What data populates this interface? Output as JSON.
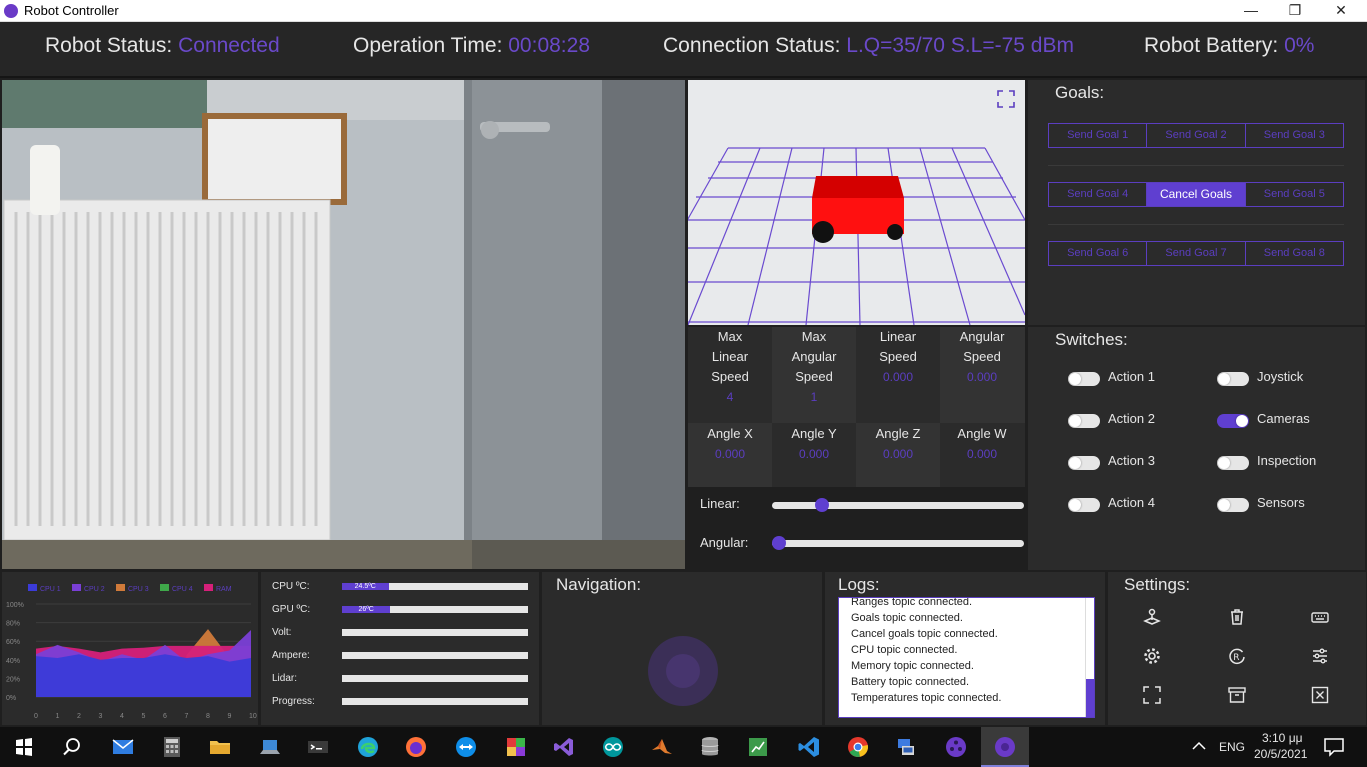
{
  "window": {
    "title": "Robot Controller",
    "minimize": "—",
    "restore": "❐",
    "close": "✕"
  },
  "status": {
    "robot_status_label": "Robot Status:",
    "robot_status_value": "Connected",
    "operation_time_label": "Operation Time:",
    "operation_time_value": "00:08:28",
    "connection_status_label": "Connection Status:",
    "connection_status_value": "L.Q=35/70 S.L=-75 dBm",
    "battery_label": "Robot Battery:",
    "battery_value": "0%"
  },
  "metrics": {
    "max_linear_label": [
      "Max",
      "Linear",
      "Speed"
    ],
    "max_linear_value": "4",
    "max_angular_label": [
      "Max",
      "Angular",
      "Speed"
    ],
    "max_angular_value": "1",
    "linear_speed_label": [
      "Linear",
      "Speed"
    ],
    "linear_speed_value": "0.000",
    "angular_speed_label": [
      "Angular",
      "Speed"
    ],
    "angular_speed_value": "0.000",
    "angle_x_label": "Angle X",
    "angle_x_value": "0.000",
    "angle_y_label": "Angle Y",
    "angle_y_value": "0.000",
    "angle_z_label": "Angle Z",
    "angle_z_value": "0.000",
    "angle_w_label": "Angle W",
    "angle_w_value": "0.000"
  },
  "sliders": {
    "linear_label": "Linear:",
    "linear_level": 0.18,
    "angular_label": "Angular:",
    "angular_level": 0.0
  },
  "goals": {
    "title": "Goals:",
    "rows": [
      [
        "Send Goal 1",
        "Send Goal 2",
        "Send Goal 3"
      ],
      [
        "Send Goal 4",
        "Cancel Goals",
        "Send Goal 5"
      ],
      [
        "Send Goal 6",
        "Send Goal 7",
        "Send Goal 8"
      ]
    ]
  },
  "switches": {
    "title": "Switches:",
    "left": [
      {
        "label": "Action 1",
        "on": false
      },
      {
        "label": "Action 2",
        "on": false
      },
      {
        "label": "Action 3",
        "on": false
      },
      {
        "label": "Action 4",
        "on": false
      }
    ],
    "right": [
      {
        "label": "Joystick",
        "on": false
      },
      {
        "label": "Cameras",
        "on": true
      },
      {
        "label": "Inspection",
        "on": false
      },
      {
        "label": "Sensors",
        "on": false
      }
    ]
  },
  "chart_data": {
    "type": "area",
    "legend": [
      "CPU 1",
      "CPU 2",
      "CPU 3",
      "CPU 4",
      "RAM"
    ],
    "legend_placement": "top",
    "colors": [
      "#3b3bd8",
      "#7a3fd6",
      "#d07a3a",
      "#3fa84a",
      "#d6207a"
    ],
    "x": [
      0,
      1,
      2,
      3,
      4,
      5,
      6,
      7,
      8,
      9,
      10
    ],
    "xlim": [
      0,
      10
    ],
    "ylim": [
      0,
      100
    ],
    "yticks": [
      "100%",
      "80%",
      "60%",
      "40%",
      "20%",
      "0%"
    ],
    "series": [
      {
        "name": "CPU 3",
        "values": [
          null,
          null,
          null,
          null,
          null,
          null,
          null,
          45,
          73,
          42,
          null
        ]
      },
      {
        "name": "RAM",
        "values": [
          52,
          55,
          52,
          48,
          52,
          53,
          55,
          55,
          55,
          55,
          55
        ]
      },
      {
        "name": "CPU 2",
        "values": [
          46,
          56,
          48,
          38,
          46,
          40,
          56,
          38,
          46,
          50,
          72
        ]
      },
      {
        "name": "CPU 1",
        "values": [
          44,
          42,
          46,
          40,
          42,
          42,
          46,
          42,
          44,
          38,
          42
        ]
      }
    ]
  },
  "telemetry": {
    "cpu_label": "CPU ºC:",
    "cpu_value": "24.5ºC",
    "cpu_level": 0.25,
    "gpu_label": "GPU ºC:",
    "gpu_value": "26ºC",
    "gpu_level": 0.26,
    "volt_label": "Volt:",
    "volt_level": 0,
    "ampere_label": "Ampere:",
    "ampere_level": 0,
    "lidar_label": "Lidar:",
    "lidar_level": 0,
    "progress_label": "Progress:",
    "progress_level": 0
  },
  "navigation": {
    "title": "Navigation:"
  },
  "logs": {
    "title": "Logs:",
    "lines": [
      "Ranges topic connected.",
      "Goals topic connected.",
      "Cancel goals topic connected.",
      "CPU topic connected.",
      "Memory topic connected.",
      "Battery topic connected.",
      "Temperatures topic connected."
    ]
  },
  "settings": {
    "title": "Settings:"
  },
  "taskbar": {
    "lang": "ENG",
    "time": "3:10 μμ",
    "date": "20/5/2021"
  },
  "colors": {
    "accent": "#5f3fd0",
    "panel": "#2b2b2b",
    "background": "#1f1f1f"
  }
}
